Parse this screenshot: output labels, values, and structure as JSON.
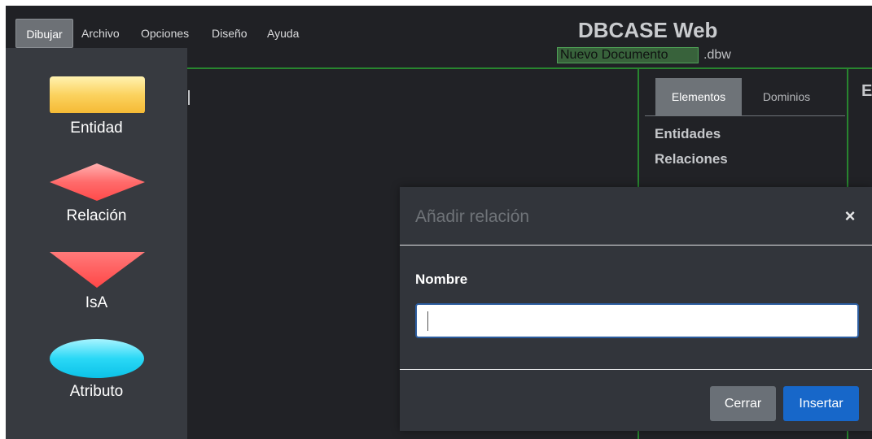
{
  "menu": {
    "items": [
      {
        "label": "Dibujar",
        "active": true
      },
      {
        "label": "Archivo",
        "active": false
      },
      {
        "label": "Opciones",
        "active": false
      },
      {
        "label": "Diseño",
        "active": false
      },
      {
        "label": "Ayuda",
        "active": false
      }
    ]
  },
  "header": {
    "title": "DBCASE Web",
    "document_name": "Nuevo Documento",
    "extension": ".dbw"
  },
  "palette": {
    "items": [
      {
        "label": "Entidad",
        "icon": "entity-rectangle-icon",
        "color": "#fbc94e"
      },
      {
        "label": "Relación",
        "icon": "relation-diamond-icon",
        "color": "#ff6868"
      },
      {
        "label": "IsA",
        "icon": "isa-triangle-icon",
        "color": "#ff6060"
      },
      {
        "label": "Atributo",
        "icon": "attribute-ellipse-icon",
        "color": "#29d6f5"
      }
    ]
  },
  "right_panel": {
    "tabs": [
      {
        "label": "Elementos",
        "active": true
      },
      {
        "label": "Dominios",
        "active": false
      }
    ],
    "elements": [
      "Entidades",
      "Relaciones"
    ],
    "cut_letter": "E"
  },
  "modal": {
    "title": "Añadir relación",
    "close_symbol": "×",
    "field_label": "Nombre",
    "field_value": "",
    "close_button": "Cerrar",
    "insert_button": "Insertar"
  },
  "colors": {
    "accent_green": "#28852f",
    "primary_button": "#1767c9",
    "secondary_button": "#6a7077"
  }
}
